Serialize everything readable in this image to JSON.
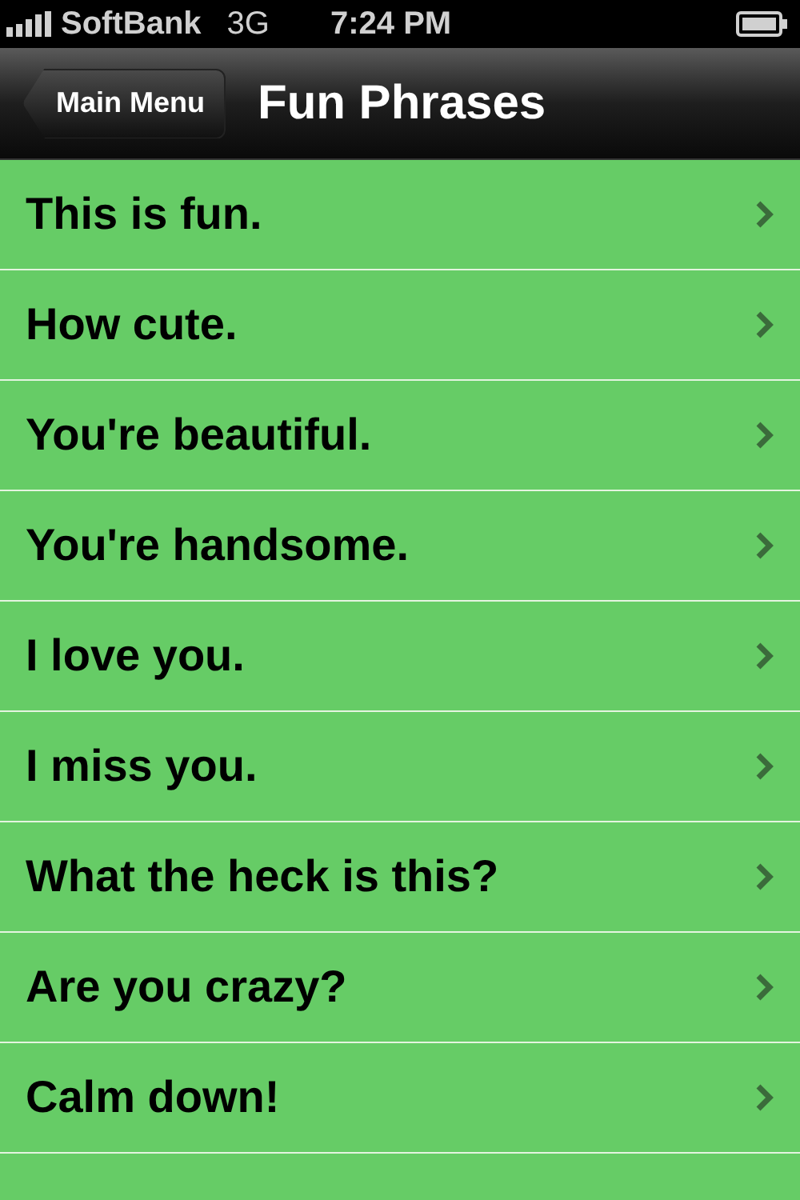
{
  "status_bar": {
    "carrier": "SoftBank",
    "network": "3G",
    "time": "7:24 PM"
  },
  "nav_bar": {
    "back_button": "Main Menu",
    "title": "Fun Phrases"
  },
  "phrases": [
    "This is fun.",
    "How cute.",
    "You're beautiful.",
    "You're handsome.",
    "I love you.",
    "I miss you.",
    "What the heck is this?",
    "Are you crazy?",
    "Calm down!"
  ]
}
